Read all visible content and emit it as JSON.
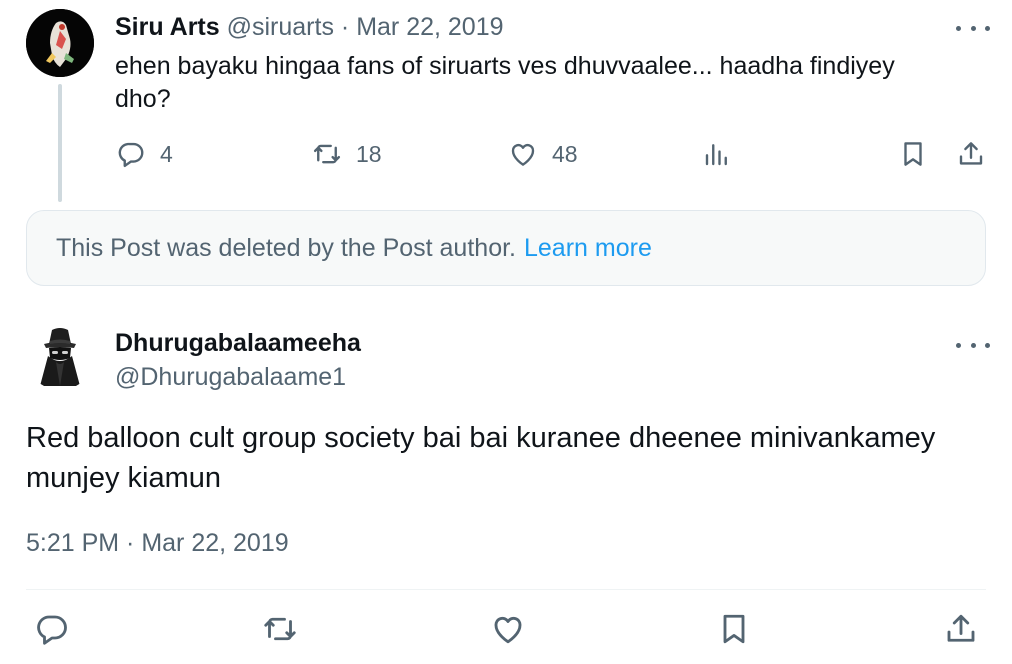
{
  "parent": {
    "name": "Siru Arts",
    "handle": "@siruarts",
    "separator": "·",
    "date": "Mar 22, 2019",
    "text": "ehen bayaku hingaa fans of siruarts ves dhuvvaalee... haadha findiyey dho?",
    "actions": {
      "replies": "4",
      "reposts": "18",
      "likes": "48"
    }
  },
  "deleted_notice": {
    "text": "This Post was deleted by the Post author.",
    "link": "Learn more"
  },
  "reply": {
    "name": "Dhurugabalaameeha",
    "handle": "@Dhurugabalaame1",
    "text": "Red balloon cult group society bai bai kuranee dheenee minivankamey munjey kiamun",
    "timestamp": "5:21 PM · Mar 22, 2019"
  },
  "colors": {
    "text": "#0f1419",
    "secondary": "#536471",
    "link": "#1d9bf0",
    "thread_line": "#cfd9de"
  },
  "icons": [
    "reply-icon",
    "repost-icon",
    "like-icon",
    "views-icon",
    "bookmark-icon",
    "share-icon",
    "more-icon"
  ]
}
